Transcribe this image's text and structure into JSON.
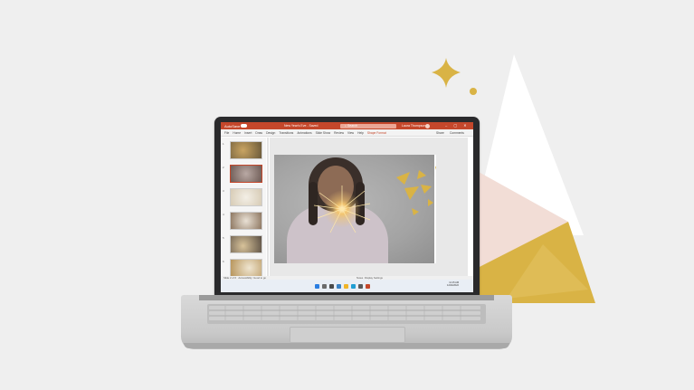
{
  "app": {
    "name": "PowerPoint",
    "autosave_label": "AutoSave",
    "document_title": "New Year's Eve - Saved",
    "search_placeholder": "Search",
    "user_name": "Laura Thompson"
  },
  "ribbon": {
    "tabs": [
      "File",
      "Home",
      "Insert",
      "Draw",
      "Design",
      "Transitions",
      "Animations",
      "Slide Show",
      "Review",
      "View",
      "Help",
      "Shape Format"
    ],
    "active_tab": "Shape Format",
    "share_label": "Share",
    "comments_label": "Comments"
  },
  "slides": {
    "numbers": [
      "1",
      "2",
      "3",
      "4",
      "5",
      "6"
    ],
    "selected_index": 2
  },
  "status": {
    "slide_info": "Slide 2 of 6",
    "accessibility": "Accessibility: Good to go",
    "notes": "Notes",
    "display_settings": "Display Settings"
  },
  "taskbar": {
    "time": "11:15 AM",
    "date": "12/24/2022"
  },
  "colors": {
    "accent": "#c4472b",
    "gold": "#d9b345",
    "blush": "#f2ddd6"
  }
}
